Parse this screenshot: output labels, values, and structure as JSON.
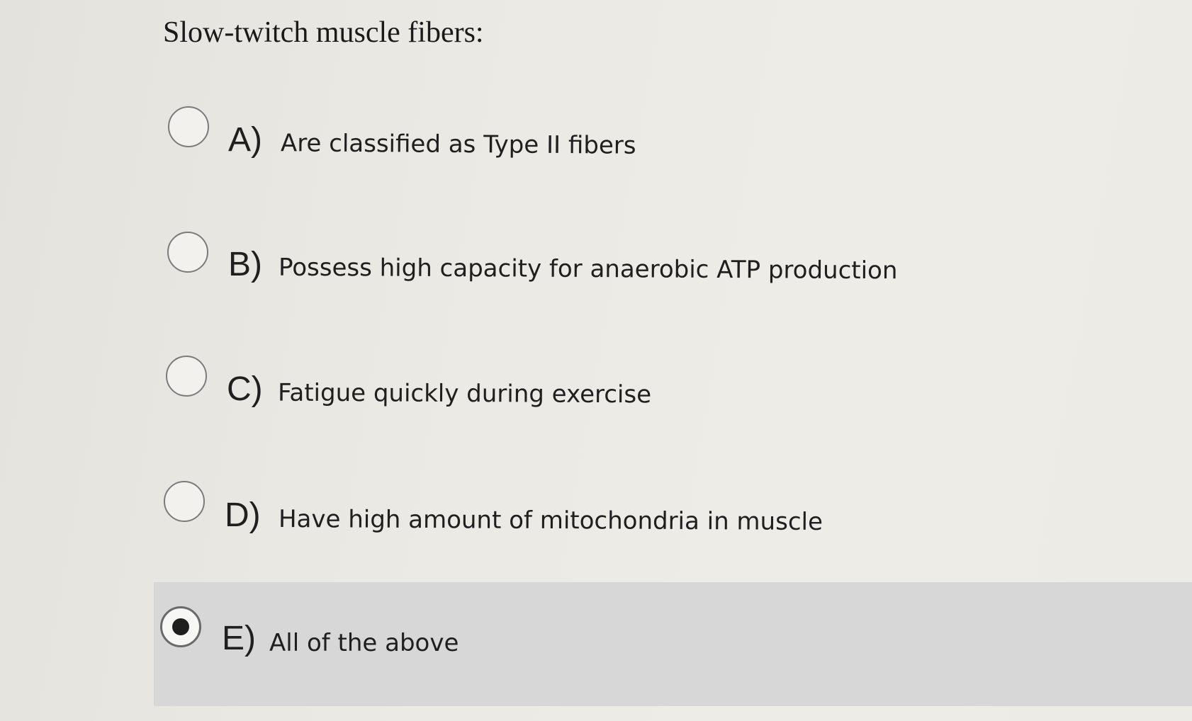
{
  "question": {
    "title": "Slow-twitch muscle fibers:"
  },
  "options": [
    {
      "letter": "A)",
      "text": "Are classified as Type II fibers",
      "selected": false
    },
    {
      "letter": "B)",
      "text": "Possess high capacity for anaerobic ATP production",
      "selected": false
    },
    {
      "letter": "C)",
      "text": "Fatigue quickly during exercise",
      "selected": false
    },
    {
      "letter": "D)",
      "text": "Have high amount of mitochondria in muscle",
      "selected": false
    },
    {
      "letter": "E)",
      "text": "All of the above",
      "selected": true
    }
  ],
  "colors": {
    "selected_highlight": "#d6d7d6",
    "radio_border": "#7b7b7b",
    "radio_dot": "#1e1e1e"
  }
}
